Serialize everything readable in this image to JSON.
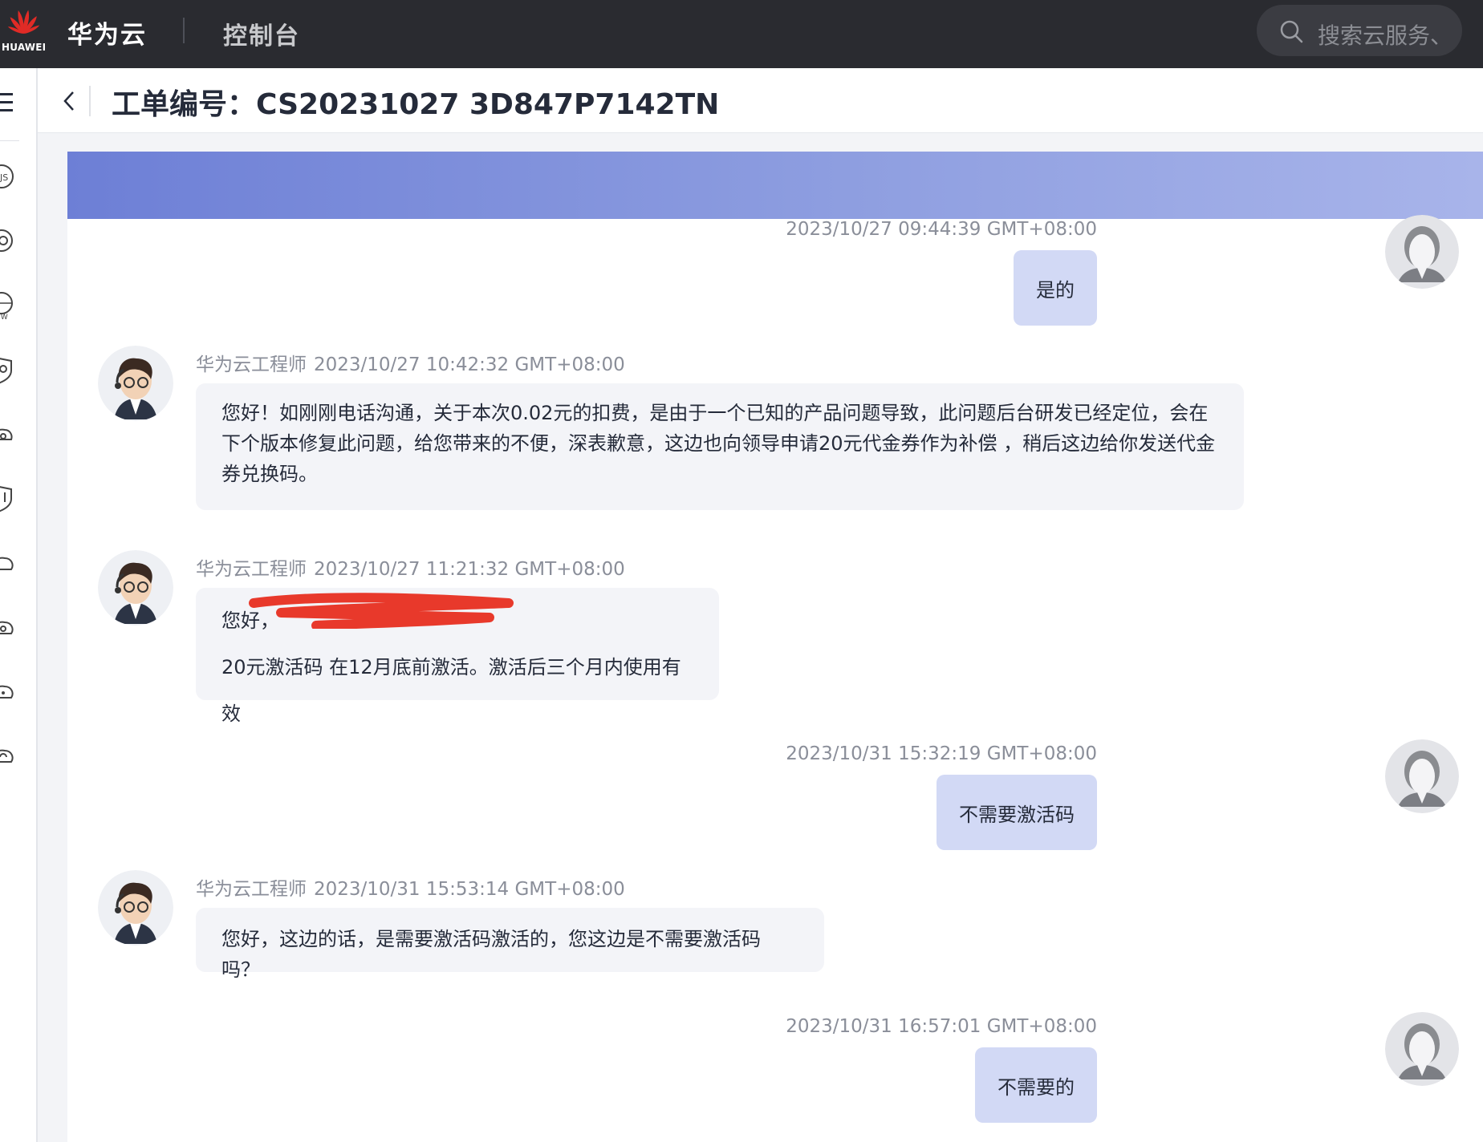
{
  "topbar": {
    "logo_text": "HUAWEI",
    "brand": "华为云",
    "console": "控制台",
    "search_placeholder": "搜索云服务、"
  },
  "header": {
    "title": "工单编号：CS20231027 3D847P7142TN"
  },
  "messages": [
    {
      "side": "user",
      "time": "2023/10/27 09:44:39 GMT+08:00",
      "text": "是的"
    },
    {
      "side": "agent",
      "sender": "华为云工程师",
      "time": "2023/10/27 10:42:32 GMT+08:00",
      "lines": [
        "您好！如刚刚电话沟通，关于本次0.02元的扣费，是由于一个已知的产品问题导致，此问题后台研发已经定位，会在",
        "下个版本修复此问题，给您带来的不便，深表歉意，这边也向领导申请20元代金券作为补偿 ，稍后这边给你发送代金",
        "券兑换码。"
      ]
    },
    {
      "side": "agent",
      "sender": "华为云工程师",
      "time": "2023/10/27 11:21:32 GMT+08:00",
      "lines": [
        "您好，",
        "20元激活码 在12月底前激活。激活后三个月内使用有效"
      ]
    },
    {
      "side": "user",
      "time": "2023/10/31 15:32:19 GMT+08:00",
      "text": "不需要激活码"
    },
    {
      "side": "agent",
      "sender": "华为云工程师",
      "time": "2023/10/31 15:53:14 GMT+08:00",
      "lines": [
        "您好，这边的话，是需要激活码激活的，您这边是不需要激活码吗？"
      ]
    },
    {
      "side": "user",
      "time": "2023/10/31 16:57:01 GMT+08:00",
      "text": "不需要的"
    }
  ],
  "colors": {
    "topbar": "#2a2b30",
    "user_bubble": "#d2d9f5",
    "agent_bubble": "#f3f4f8",
    "redaction": "#e8392b",
    "banner_start": "#6d7fd6",
    "banner_end": "#a8b4ea"
  },
  "icons": {
    "menu": "hamburger-icon",
    "back": "chevron-left-icon",
    "search": "search-icon"
  }
}
